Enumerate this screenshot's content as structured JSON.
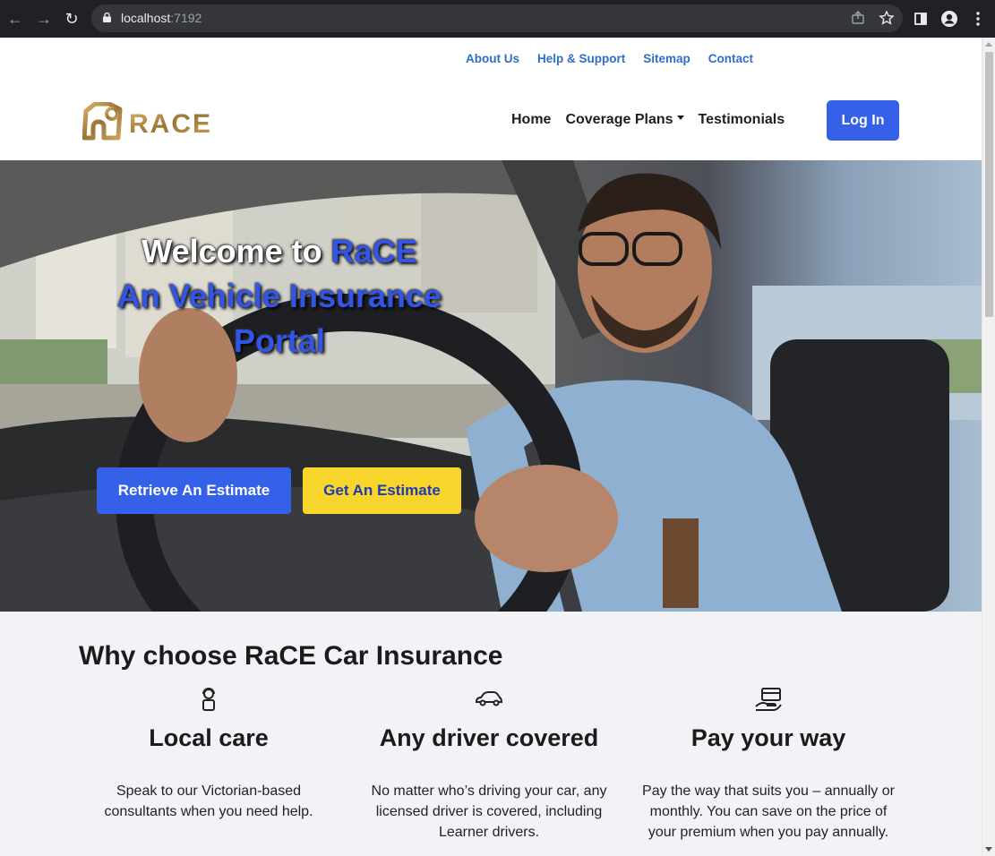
{
  "browser": {
    "url_host": "localhost",
    "url_port": ":7192"
  },
  "toplinks": {
    "about": "About Us",
    "help": "Help & Support",
    "sitemap": "Sitemap",
    "contact": "Contact"
  },
  "logo_text": "RACE",
  "nav": {
    "home": "Home",
    "coverage": "Coverage Plans",
    "testimonials": "Testimonials",
    "login": "Log In"
  },
  "hero": {
    "welcome": "Welcome to",
    "brand": "RaCE",
    "line2": "An Vehicle Insurance",
    "line3": "Portal",
    "retrieve_button": "Retrieve An Estimate",
    "get_button": "Get An Estimate"
  },
  "why": {
    "title": "Why choose RaCE Car Insurance",
    "features": [
      {
        "icon": "person-headset-icon",
        "title": "Local care",
        "text": "Speak to our Victorian-based consultants when you need help."
      },
      {
        "icon": "car-icon",
        "title": "Any driver covered",
        "text": "No matter who’s driving your car, any licensed driver is covered, including Learner drivers."
      },
      {
        "icon": "hand-card-icon",
        "title": "Pay your way",
        "text": "Pay the way that suits you – annually or monthly. You can save on the price of your premium when you pay annually."
      }
    ]
  },
  "colors": {
    "primary": "#3560e8",
    "accent_yellow": "#f7d52b",
    "link": "#2f6ec9",
    "section_bg": "#f2f3f7"
  }
}
